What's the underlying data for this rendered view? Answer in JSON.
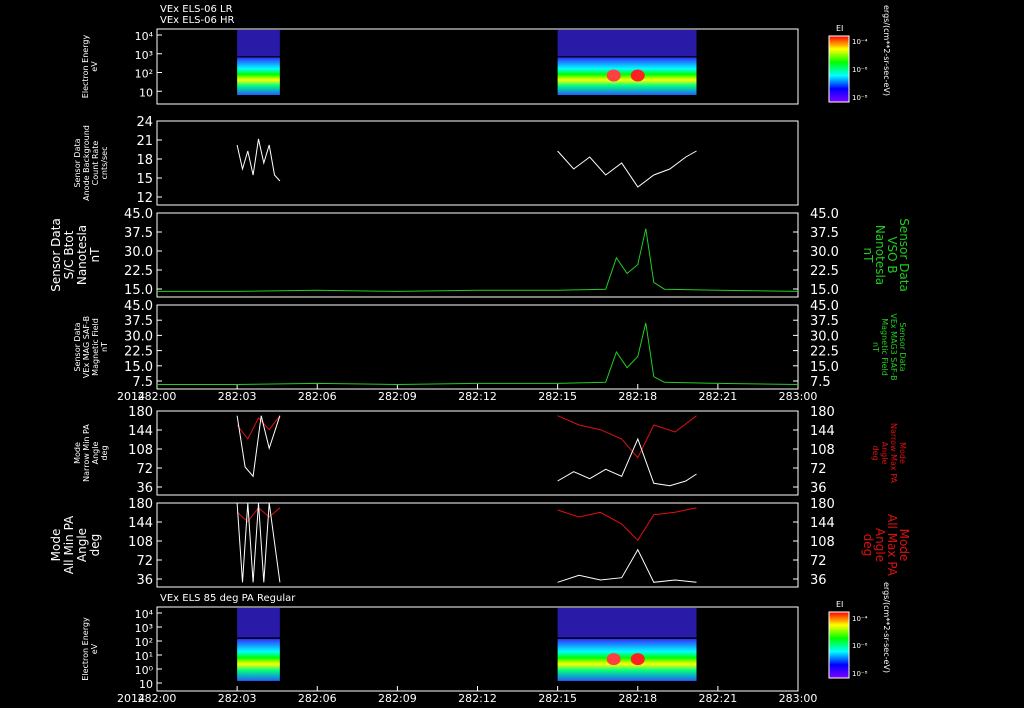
{
  "header": {
    "line1": "VEx ELS-06 LR",
    "line2": "VEx ELS-06 HR",
    "panel7_title": "VEx ELS 85 deg PA Regular"
  },
  "colorbar": {
    "label": "EI",
    "top_tick": "10⁻⁴",
    "mid_tick": "10⁻⁶",
    "bottom_tick": "10⁻⁸",
    "unit": "ergs/(cm**2-sr-sec-eV)"
  },
  "colors": {
    "axis": "#ffffff",
    "green": "#22cc22",
    "red": "#dd1111",
    "white": "#ffffff"
  },
  "time_axis": {
    "year": "2014",
    "ticks": [
      "282:00",
      "282:03",
      "282:06",
      "282:09",
      "282:12",
      "282:15",
      "282:18",
      "282:21",
      "283:00"
    ],
    "range_hours": [
      0,
      24
    ]
  },
  "panels": [
    {
      "id": "p1",
      "ylabel": [
        "Electron Energy",
        "eV"
      ],
      "yticks": [
        "10⁴",
        "10³",
        "10²",
        "10"
      ],
      "type": "spectrogram"
    },
    {
      "id": "p2",
      "ylabel": [
        "Sensor Data",
        "Anode Background",
        "Count Rate",
        "cnts/sec"
      ],
      "yticks": [
        "24",
        "21",
        "18",
        "15",
        "12"
      ],
      "ylim": [
        10,
        24
      ],
      "type": "line"
    },
    {
      "id": "p3",
      "ylabel": [
        "Sensor Data",
        "S/C Btot",
        "Nanotesla",
        "nT"
      ],
      "right_label": [
        "Sensor Data",
        "VSO B",
        "Nanotesla",
        "nT"
      ],
      "yticks": [
        "45.0",
        "37.5",
        "30.0",
        "22.5",
        "15.0"
      ],
      "ylim": [
        7.5,
        45
      ],
      "type": "line"
    },
    {
      "id": "p4",
      "ylabel": [
        "Sensor Data",
        "VEx MAG SAF-B",
        "Magnetic Field",
        "nT"
      ],
      "right_label": [
        "Sensor Data",
        "VEx MAG3 SAF-B",
        "Magnetic Field",
        "nT"
      ],
      "yticks": [
        "45.0",
        "37.5",
        "30.0",
        "22.5",
        "15.0",
        "7.5"
      ],
      "ylim": [
        7.5,
        45
      ],
      "type": "line"
    },
    {
      "id": "p5",
      "ylabel": [
        "Mode",
        "Narrow Min PA",
        "Angle",
        "deg"
      ],
      "right_label": [
        "Mode",
        "Narrow Max PA",
        "Angle",
        "deg"
      ],
      "yticks": [
        "180",
        "144",
        "108",
        "72",
        "36"
      ],
      "ylim": [
        0,
        180
      ],
      "type": "line"
    },
    {
      "id": "p6",
      "ylabel": [
        "Mode",
        "All Min PA",
        "Angle",
        "deg"
      ],
      "right_label": [
        "Mode",
        "All Max PA",
        "Angle",
        "deg"
      ],
      "yticks": [
        "180",
        "144",
        "108",
        "72",
        "36"
      ],
      "ylim": [
        0,
        180
      ],
      "type": "line"
    },
    {
      "id": "p7",
      "ylabel": [
        "Electron Energy",
        "eV"
      ],
      "yticks": [
        "10⁴",
        "10³",
        "10²",
        "10¹",
        "10⁰",
        "10"
      ],
      "type": "spectrogram"
    }
  ],
  "chart_data": {
    "type": "line",
    "x_units": "hours after 282:00",
    "data_intervals": [
      [
        3.0,
        4.6
      ],
      [
        15.0,
        20.2
      ]
    ],
    "series": [
      {
        "panel": "p2",
        "color": "white",
        "segments": [
          {
            "x": [
              3.0,
              3.2,
              3.4,
              3.6,
              3.8,
              4.0,
              4.2,
              4.4,
              4.6
            ],
            "y": [
              20,
              16,
              19,
              15,
              21,
              17,
              20,
              15,
              14
            ]
          },
          {
            "x": [
              15.0,
              15.6,
              16.2,
              16.8,
              17.4,
              18.0,
              18.6,
              19.2,
              19.8,
              20.2
            ],
            "y": [
              19,
              16,
              18,
              15,
              17,
              13,
              15,
              16,
              18,
              19
            ]
          }
        ]
      },
      {
        "panel": "p3",
        "color": "green",
        "segments": [
          {
            "x": [
              0,
              3,
              6,
              9,
              12,
              15,
              16.8,
              17.2,
              17.6,
              18.0,
              18.3,
              18.6,
              19.0,
              21,
              24
            ],
            "y": [
              10,
              10,
              10.5,
              10,
              10.5,
              10.5,
              11,
              25,
              18,
              22,
              38,
              14,
              11,
              10.5,
              10
            ]
          }
        ]
      },
      {
        "panel": "p4",
        "color": "green",
        "segments": [
          {
            "x": [
              0,
              3,
              6,
              9,
              12,
              15,
              16.8,
              17.2,
              17.6,
              18.0,
              18.3,
              18.6,
              19.0,
              21,
              24
            ],
            "y": [
              9.5,
              9.5,
              10,
              9.5,
              10,
              10,
              10.5,
              24,
              17,
              22,
              37,
              13,
              10.5,
              10,
              9.5
            ]
          }
        ]
      },
      {
        "panel": "p5",
        "color": "red",
        "segments": [
          {
            "x": [
              3.0,
              3.4,
              3.8,
              4.2,
              4.6
            ],
            "y": [
              150,
              120,
              165,
              140,
              170
            ]
          },
          {
            "x": [
              15.0,
              15.8,
              16.6,
              17.4,
              18.0,
              18.6,
              19.4,
              20.2
            ],
            "y": [
              170,
              150,
              140,
              120,
              80,
              150,
              135,
              170
            ]
          }
        ]
      },
      {
        "panel": "p5",
        "color": "white",
        "segments": [
          {
            "x": [
              3.0,
              3.3,
              3.6,
              3.9,
              4.2,
              4.6
            ],
            "y": [
              170,
              60,
              40,
              170,
              100,
              170
            ]
          },
          {
            "x": [
              15.0,
              15.6,
              16.2,
              16.8,
              17.4,
              18.0,
              18.6,
              19.2,
              19.8,
              20.2
            ],
            "y": [
              30,
              50,
              35,
              55,
              40,
              120,
              25,
              20,
              30,
              45
            ]
          }
        ]
      },
      {
        "panel": "p6",
        "color": "red",
        "segments": [
          {
            "x": [
              3.0,
              3.4,
              3.8,
              4.2,
              4.6
            ],
            "y": [
              160,
              140,
              170,
              150,
              170
            ]
          },
          {
            "x": [
              15.0,
              15.8,
              16.6,
              17.4,
              18.0,
              18.6,
              19.4,
              20.2
            ],
            "y": [
              165,
              150,
              160,
              135,
              100,
              155,
              160,
              170
            ]
          }
        ]
      },
      {
        "panel": "p6",
        "color": "white",
        "segments": [
          {
            "x": [
              3.0,
              3.2,
              3.4,
              3.6,
              3.8,
              4.0,
              4.2,
              4.6
            ],
            "y": [
              180,
              10,
              180,
              10,
              180,
              10,
              180,
              10
            ]
          },
          {
            "x": [
              15.0,
              15.8,
              16.6,
              17.4,
              18.0,
              18.6,
              19.4,
              20.2
            ],
            "y": [
              10,
              25,
              15,
              20,
              80,
              10,
              15,
              10
            ]
          }
        ]
      }
    ]
  }
}
